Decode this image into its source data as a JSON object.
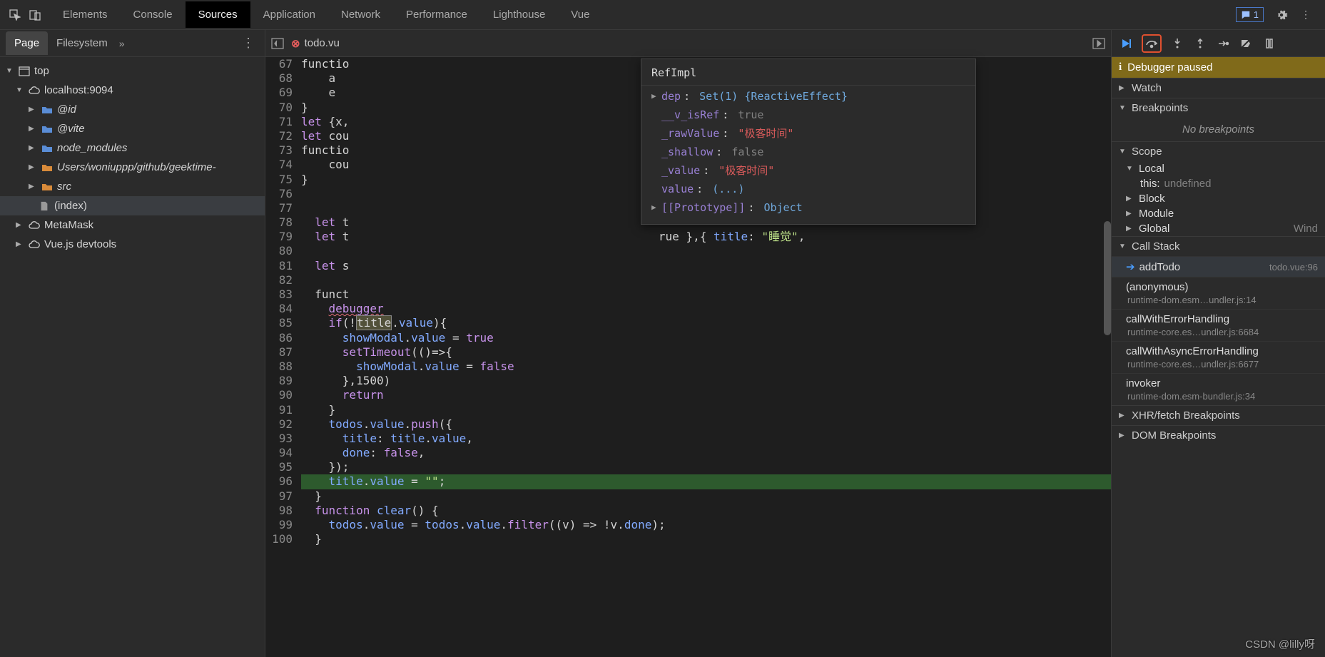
{
  "topTabs": [
    "Elements",
    "Console",
    "Sources",
    "Application",
    "Network",
    "Performance",
    "Lighthouse",
    "Vue"
  ],
  "activeTopTab": "Sources",
  "chatCount": "1",
  "sidebarTabs": {
    "page": "Page",
    "filesystem": "Filesystem"
  },
  "tree": {
    "top": "top",
    "host": "localhost:9094",
    "folders": [
      "@id",
      "@vite",
      "node_modules",
      "Users/woniuppp/github/geektime-",
      "src"
    ],
    "index": "(index)",
    "metamask": "MetaMask",
    "vuedev": "Vue.js devtools"
  },
  "fileTab": "todo.vu",
  "tooltip": {
    "title": "RefImpl",
    "rows": [
      {
        "caret": "▶",
        "key": "dep",
        "sep": ": ",
        "val": "Set(1) {ReactiveEffect}",
        "cls": "tt-val-blue"
      },
      {
        "caret": "",
        "key": "__v_isRef",
        "sep": ": ",
        "val": "true",
        "cls": "tt-val-kw"
      },
      {
        "caret": "",
        "key": "_rawValue",
        "sep": ": ",
        "val": "\"极客时间\"",
        "cls": "tt-val-str"
      },
      {
        "caret": "",
        "key": "_shallow",
        "sep": ": ",
        "val": "false",
        "cls": "tt-val-kw"
      },
      {
        "caret": "",
        "key": "_value",
        "sep": ": ",
        "val": "\"极客时间\"",
        "cls": "tt-val-str"
      },
      {
        "caret": "",
        "key": "value",
        "sep": ": ",
        "val": "(...)",
        "cls": "tt-val-blue"
      },
      {
        "caret": "▶",
        "key": "[[Prototype]]",
        "sep": ": ",
        "val": "Object",
        "cls": "tt-val-blue"
      }
    ]
  },
  "code": {
    "start": 67,
    "lines": [
      "functio",
      "    a",
      "    e",
      "}",
      "let {x,",
      "let cou",
      "functio",
      "    cou",
      "}",
      "",
      "",
      "  let t",
      "  let t                                             rue },{ title: \"睡觉\", ",
      "",
      "  let s",
      "",
      "  funct",
      "    debugger",
      "    if(!title.value){",
      "      showModal.value = true",
      "      setTimeout(()=>{",
      "        showModal.value = false",
      "      },1500)",
      "      return",
      "    }",
      "    todos.value.push({",
      "      title: title.value,",
      "      done: false,",
      "    });",
      "    title.value = \"\";",
      "  }",
      "  function clear() {",
      "    todos.value = todos.value.filter((v) => !v.done);",
      "  }"
    ]
  },
  "debugger": {
    "pausedMsg": "Debugger paused",
    "sections": {
      "watch": "Watch",
      "breakpoints": "Breakpoints",
      "noBp": "No breakpoints",
      "scope": "Scope",
      "callstack": "Call Stack",
      "xhr": "XHR/fetch Breakpoints",
      "dom": "DOM Breakpoints"
    },
    "scope": [
      {
        "label": "Local",
        "expand": true
      },
      {
        "indent": true,
        "key": "this",
        "val": "undefined"
      },
      {
        "label": "Block"
      },
      {
        "label": "Module"
      },
      {
        "label": "Global",
        "right": "Wind"
      }
    ],
    "stack": [
      {
        "name": "addTodo",
        "loc": "todo.vue:96",
        "active": true
      },
      {
        "name": "(anonymous)",
        "sub": "runtime-dom.esm…undler.js:14"
      },
      {
        "name": "callWithErrorHandling",
        "sub": "runtime-core.es…undler.js:6684"
      },
      {
        "name": "callWithAsyncErrorHandling",
        "sub": "runtime-core.es…undler.js:6677"
      },
      {
        "name": "invoker",
        "sub": "runtime-dom.esm-bundler.js:34"
      }
    ]
  },
  "watermark": "CSDN @lilly呀"
}
